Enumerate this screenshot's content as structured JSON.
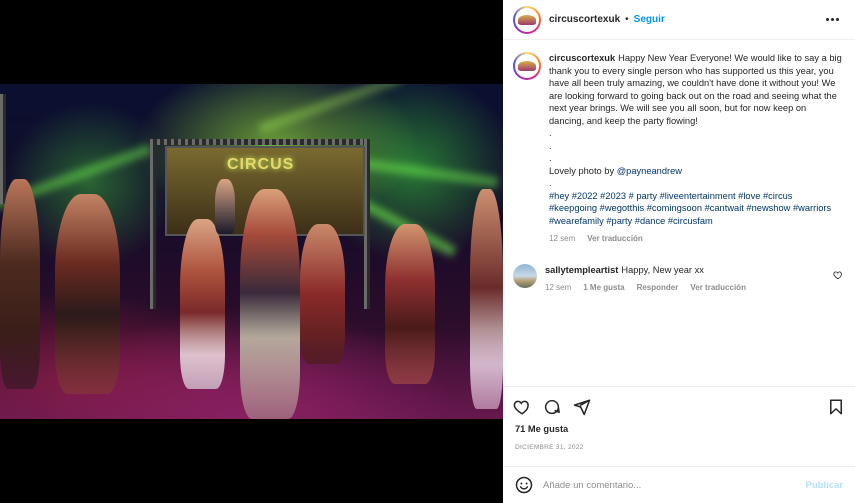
{
  "post": {
    "username": "circuscortexuk",
    "follow_label": "Seguir",
    "dot": "•"
  },
  "caption": {
    "username": "circuscortexuk",
    "text": "Happy New Year Everyone! We would like to say a big thank you to every single person who has supported us this year, you have all been truly amazing, we couldn't have done it without you! We are looking forward to going back out on the road and seeing what the next year brings. We will see you all soon, but for now keep on dancing, and keep the party flowing!",
    "dots": [
      ".",
      ".",
      "."
    ],
    "photo_credit_prefix": "Lovely photo by ",
    "photo_credit_handle": "@payneandrew",
    "dot_after": ".",
    "hashtags": "#hey #2022 #2023 # party #liveentertainment #love #circus #keepgoing #wegotthis #comingsoon #cantwait #newshow #warriors #wearefamily #party #dance #circusfam",
    "time": "12 sem",
    "see_translation": "Ver traducción"
  },
  "comment": {
    "username": "sallytempleartist",
    "text": "Happy, New year xx",
    "time": "12 sem",
    "likes": "1 Me gusta",
    "reply": "Responder",
    "see_translation": "Ver traducción"
  },
  "photo": {
    "stage_sign": "CIRCUS"
  },
  "stats": {
    "likes": "71 Me gusta",
    "date": "DICIEMBRE 31, 2022"
  },
  "add_comment": {
    "placeholder": "Añade un comentario...",
    "publish": "Publicar"
  },
  "icons": {
    "like": "heart-icon",
    "comment": "comment-icon",
    "share": "share-icon",
    "save": "bookmark-icon",
    "emoji": "emoji-icon",
    "more": "more-options-icon"
  },
  "colors": {
    "accent": "#0095f6",
    "link": "#00376b",
    "muted": "#8e8e8e",
    "publish_disabled": "#b2dffc"
  }
}
